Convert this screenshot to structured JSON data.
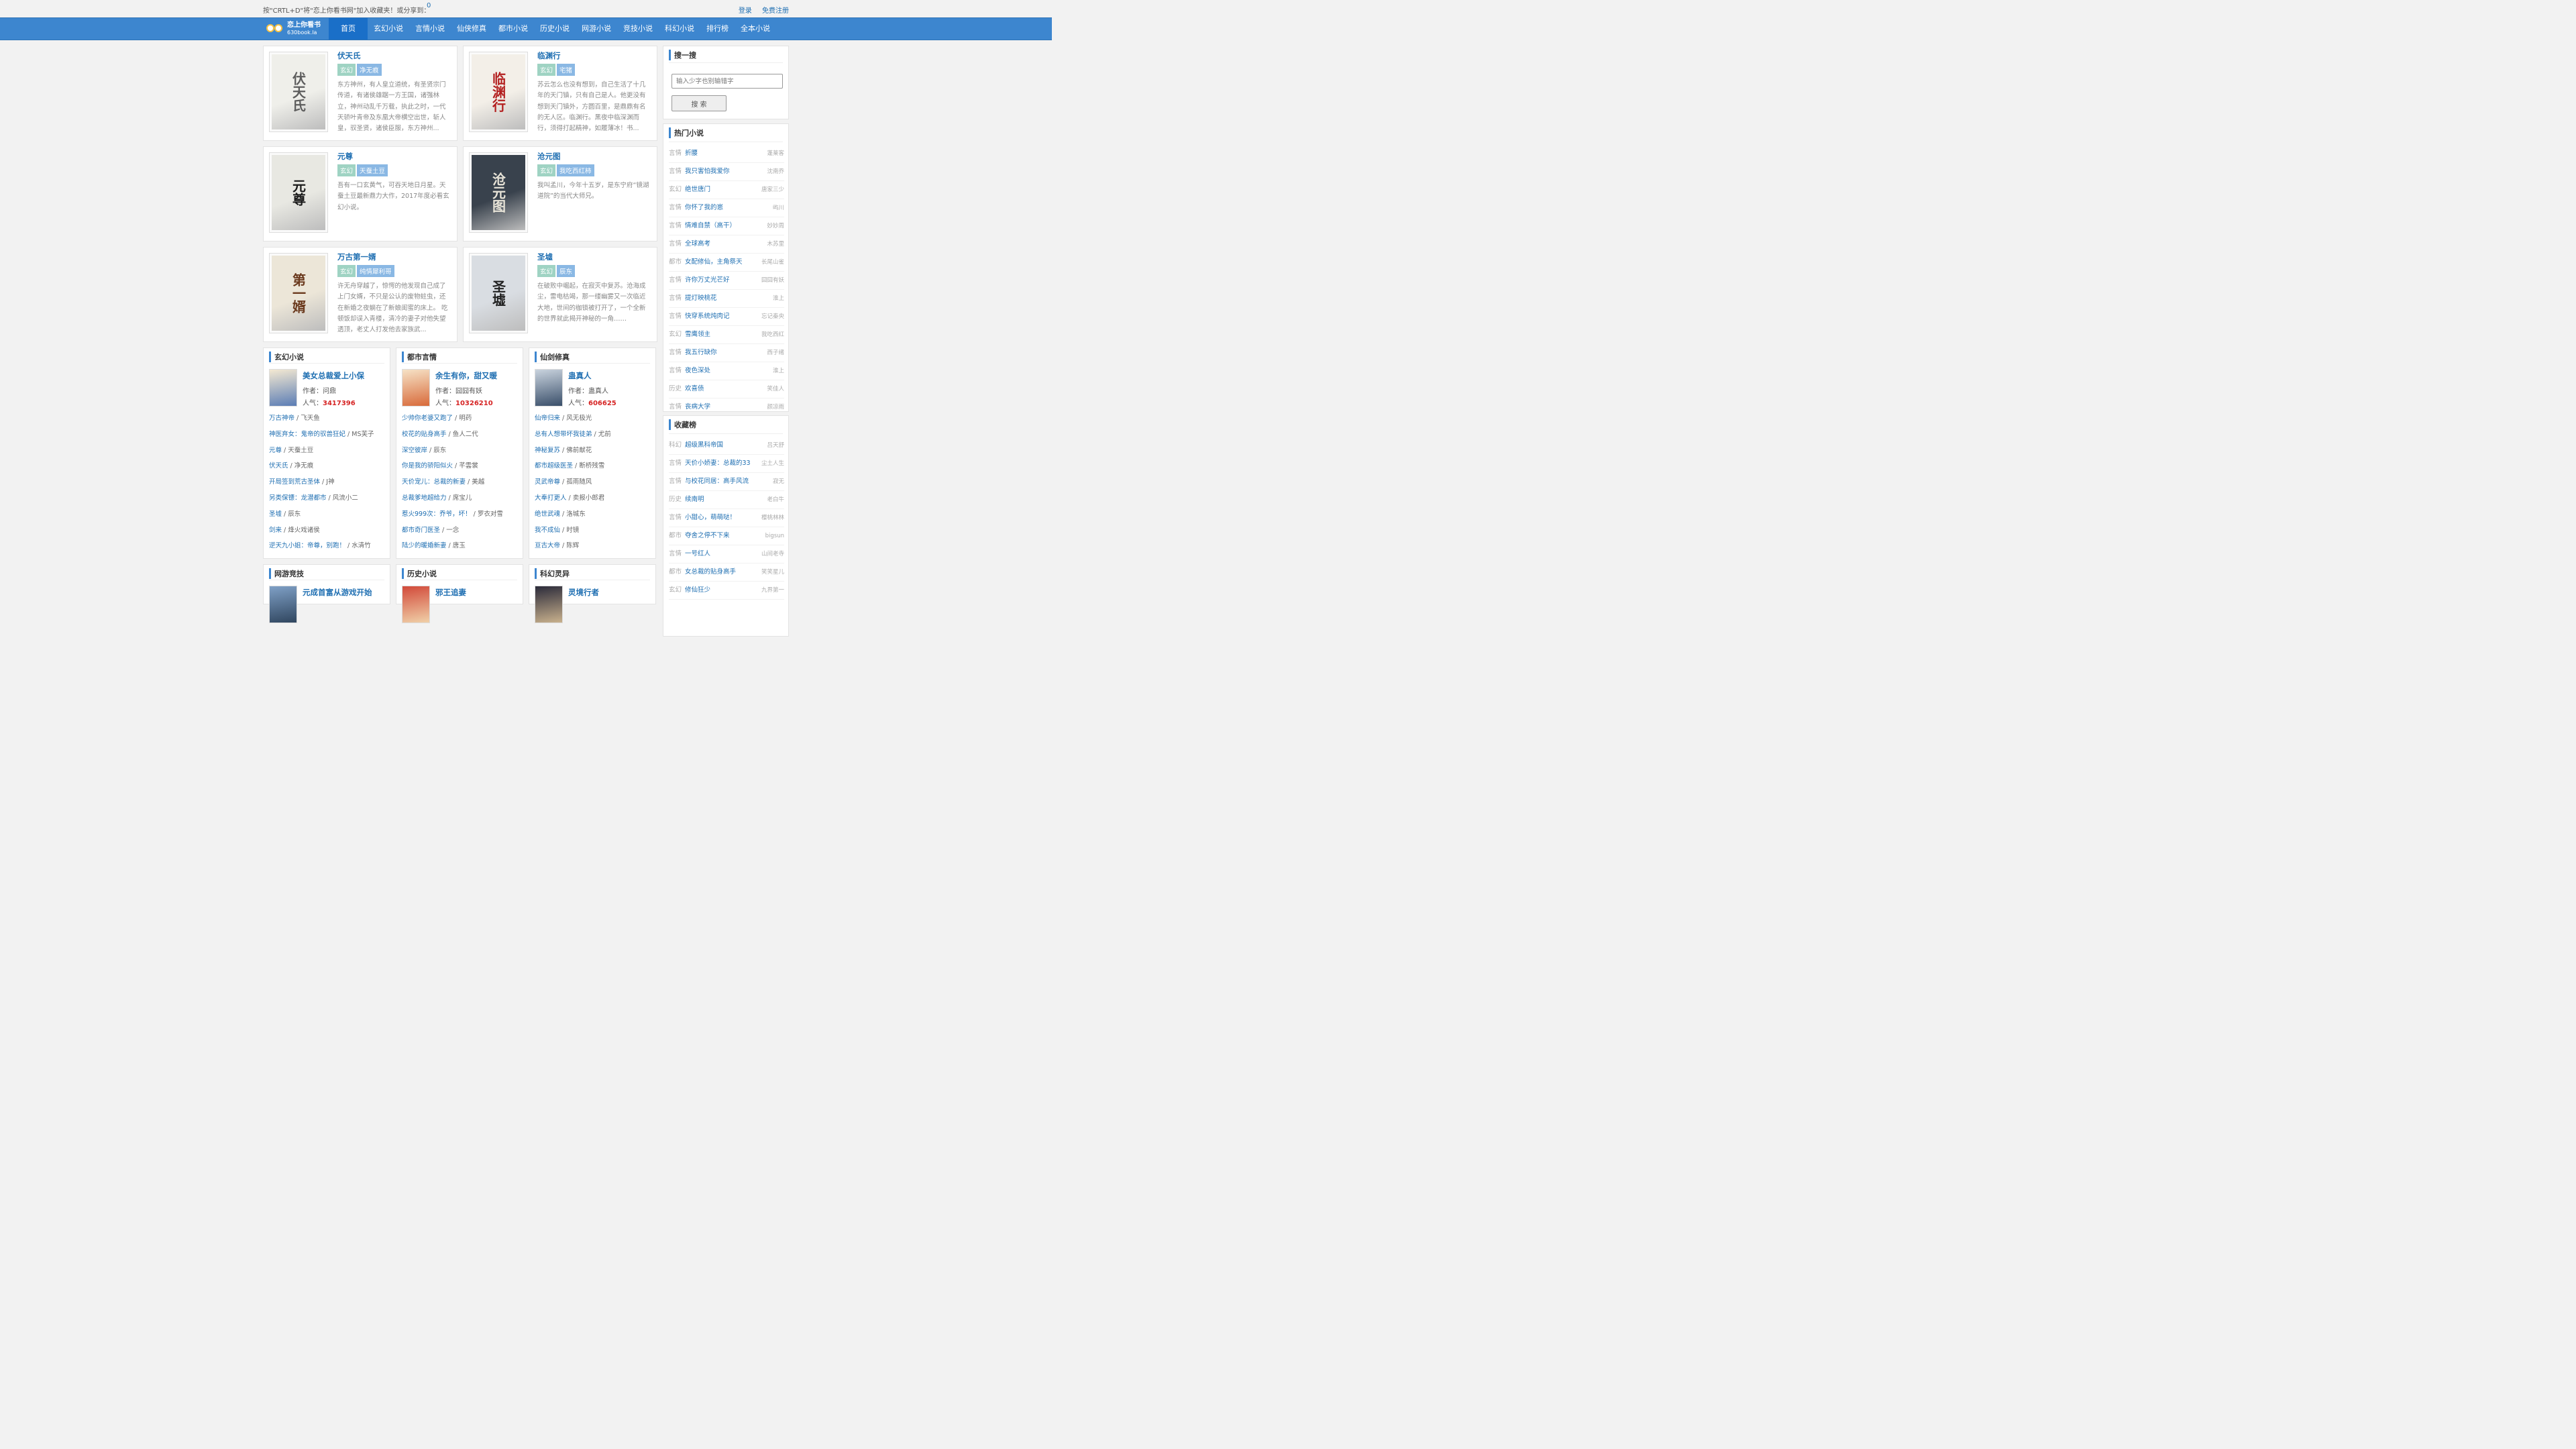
{
  "topbar": {
    "message": "按\"CRTL+D\"将\"恋上你看书网\"加入收藏夹！或分享到：",
    "count": "0",
    "login": "登录",
    "register": "免费注册"
  },
  "logo": {
    "name": "恋上你看书",
    "domain": "630book.la"
  },
  "nav": [
    "首页",
    "玄幻小说",
    "言情小说",
    "仙侠修真",
    "都市小说",
    "历史小说",
    "网游小说",
    "竞技小说",
    "科幻小说",
    "排行榜",
    "全本小说"
  ],
  "featured": [
    {
      "title": "伏天氏",
      "tags": [
        "玄幻",
        "净无痕"
      ],
      "intro": "东方神州，有人皇立道统，有圣贤宗门传道，有诸侯雄踞一方王国，诸强林立，神州动乱千万载，执此之时，一代天骄叶青帝及东凰大帝横空出世，斩人皇，驭圣贤，诸侯臣服，东方神州...",
      "cover_text": "伏天氏",
      "cover_colors": [
        "#efefea",
        "#5d5d5d"
      ]
    },
    {
      "title": "临渊行",
      "tags": [
        "玄幻",
        "宅猪"
      ],
      "intro": "苏云怎么也没有想到，自己生活了十几年的天门镇，只有自己是人。他更没有想到天门镇外，方圆百里，是鼎鼎有名的无人区。临渊行。黑夜中临深渊而行，须得打起精神，如履薄冰！书...",
      "cover_text": "临渊行",
      "cover_colors": [
        "#f3efe8",
        "#b31f1f"
      ]
    },
    {
      "title": "元尊",
      "tags": [
        "玄幻",
        "天蚕土豆"
      ],
      "intro": "吾有一口玄黄气，可吞天地日月星。天蚕土豆最新鼎力大作，2017年度必看玄幻小说。",
      "cover_text": "元尊",
      "cover_colors": [
        "#e8e8e2",
        "#1a1a1a"
      ]
    },
    {
      "title": "沧元图",
      "tags": [
        "玄幻",
        "我吃西红柿"
      ],
      "intro": "我叫孟川，今年十五岁，是东宁府“镜湖道院”的当代大师兄。",
      "cover_text": "沧元图",
      "cover_colors": [
        "#39424d",
        "#e8e4d8"
      ]
    },
    {
      "title": "万古第一婿",
      "tags": [
        "玄幻",
        "纯情犀利哥"
      ],
      "intro": "许无舟穿越了，惊愕的他发现自己成了上门女婿，不只是公认的废物蛀虫，还在新婚之夜躺在了新娘闺蜜的床上。 吃顿饭却误入青楼，清冷的妻子对他失望透顶，老丈人打发他去家族武...",
      "cover_text": "第一婿",
      "cover_colors": [
        "#ece6d8",
        "#6b3a1e"
      ]
    },
    {
      "title": "圣墟",
      "tags": [
        "玄幻",
        "辰东"
      ],
      "intro": "在破败中崛起，在寂灭中复苏。沧海成尘，雷电枯竭，那一缕幽雾又一次临近大地，世间的枷锁被打开了，一个全新的世界就此揭开神秘的一角……",
      "cover_text": "圣墟",
      "cover_colors": [
        "#d9dde2",
        "#222222"
      ]
    }
  ],
  "categories": [
    {
      "name": "玄幻小说",
      "top": {
        "title": "美女总裁爱上小保",
        "author_label": "作者：",
        "author": "问鼎",
        "hot_label": "人气：",
        "hot": "3417396"
      },
      "list": [
        [
          "万古神帝",
          "飞天鱼"
        ],
        [
          "神医弃女：鬼帝的驭兽狂妃",
          "MS芙子"
        ],
        [
          "元尊",
          "天蚕土豆"
        ],
        [
          "伏天氏",
          "净无痕"
        ],
        [
          "开局签到荒古圣体",
          "J神"
        ],
        [
          "另类保镖：龙潜都市",
          "风流小二"
        ],
        [
          "圣墟",
          "辰东"
        ],
        [
          "剑来",
          "烽火戏诸侯"
        ],
        [
          "逆天九小姐：帝尊，别跑！",
          "水清竹"
        ]
      ]
    },
    {
      "name": "都市言情",
      "top": {
        "title": "余生有你，甜又暖",
        "author_label": "作者：",
        "author": "囧囧有妖",
        "hot_label": "人气：",
        "hot": "10326210"
      },
      "list": [
        [
          "少帅你老婆又跑了",
          "明药"
        ],
        [
          "校花的贴身高手",
          "鱼人二代"
        ],
        [
          "深空彼岸",
          "辰东"
        ],
        [
          "你是我的骄阳似火",
          "芊雲裳"
        ],
        [
          "天价宠儿：总裁的新妻",
          "美越"
        ],
        [
          "总裁爹地超给力",
          "席宝儿"
        ],
        [
          "惹火999次：乔爷，坏！",
          "罗衣对雪"
        ],
        [
          "都市奇门医圣",
          "一念"
        ],
        [
          "陆少的暖婚新妻",
          "唐玉"
        ]
      ]
    },
    {
      "name": "仙剑修真",
      "top": {
        "title": "蛊真人",
        "author_label": "作者：",
        "author": "蛊真人",
        "hot_label": "人气：",
        "hot": "606625"
      },
      "list": [
        [
          "仙帝归来",
          "风无极光"
        ],
        [
          "总有人想带坏我徒弟",
          "尤前"
        ],
        [
          "神秘复苏",
          "佛前献花"
        ],
        [
          "都市超级医圣",
          "断桥残雪"
        ],
        [
          "灵武帝尊",
          "孤雨随风"
        ],
        [
          "大奉打更人",
          "卖报小郎君"
        ],
        [
          "绝世武魂",
          "洛城东"
        ],
        [
          "我不成仙",
          "时镜"
        ],
        [
          "亘古大帝",
          "陈辉"
        ]
      ]
    },
    {
      "name": "网游竞技",
      "top": {
        "title": "元成首富从游戏开始"
      }
    },
    {
      "name": "历史小说",
      "top": {
        "title": "邪王追妻"
      }
    },
    {
      "name": "科幻灵异",
      "top": {
        "title": "灵境行者"
      }
    }
  ],
  "search": {
    "title": "搜一搜",
    "placeholder": "输入少字也别输错字",
    "button": "搜 索"
  },
  "hot": {
    "title": "热门小说",
    "items": [
      [
        "言情",
        "折腰",
        "蓬莱客"
      ],
      [
        "言情",
        "我只害怕我爱你",
        "沈南乔"
      ],
      [
        "玄幻",
        "绝世唐门",
        "唐家三少"
      ],
      [
        "言情",
        "你怀了我的崽",
        "屿川"
      ],
      [
        "言情",
        "情难自禁（高干）",
        "妙妙周"
      ],
      [
        "言情",
        "全球高考",
        "木苏里"
      ],
      [
        "都市",
        "女配修仙，主角祭天",
        "长尾山雀"
      ],
      [
        "言情",
        "许你万丈光芒好",
        "囧囧有妖"
      ],
      [
        "言情",
        "提灯映桃花",
        "淮上"
      ],
      [
        "言情",
        "快穿系统炖肉记",
        "忘记秦央"
      ],
      [
        "玄幻",
        "雪鹰领主",
        "我吃西红"
      ],
      [
        "言情",
        "我五行缺你",
        "西子绪"
      ],
      [
        "言情",
        "夜色深处",
        "淮上"
      ],
      [
        "历史",
        "欢喜债",
        "笑佳人"
      ],
      [
        "言情",
        "丧病大学",
        "颜凉雨"
      ]
    ]
  },
  "fav": {
    "title": "收藏榜",
    "items": [
      [
        "科幻",
        "超级黑科帝国",
        "吕天舒"
      ],
      [
        "言情",
        "天价小娇妻：总裁的33",
        "尘土人生"
      ],
      [
        "言情",
        "与校花同居：高手风流",
        "寂无"
      ],
      [
        "历史",
        "续南明",
        "老白牛"
      ],
      [
        "言情",
        "小甜心，萌萌哒！",
        "樱桃林林"
      ],
      [
        "都市",
        "夺舍之停不下来",
        "bigsun"
      ],
      [
        "言情",
        "一号红人",
        "山间老寺"
      ],
      [
        "都市",
        "女总裁的贴身高手",
        "笑笑星儿"
      ],
      [
        "玄幻",
        "修仙狂少",
        "九界第一"
      ]
    ]
  }
}
